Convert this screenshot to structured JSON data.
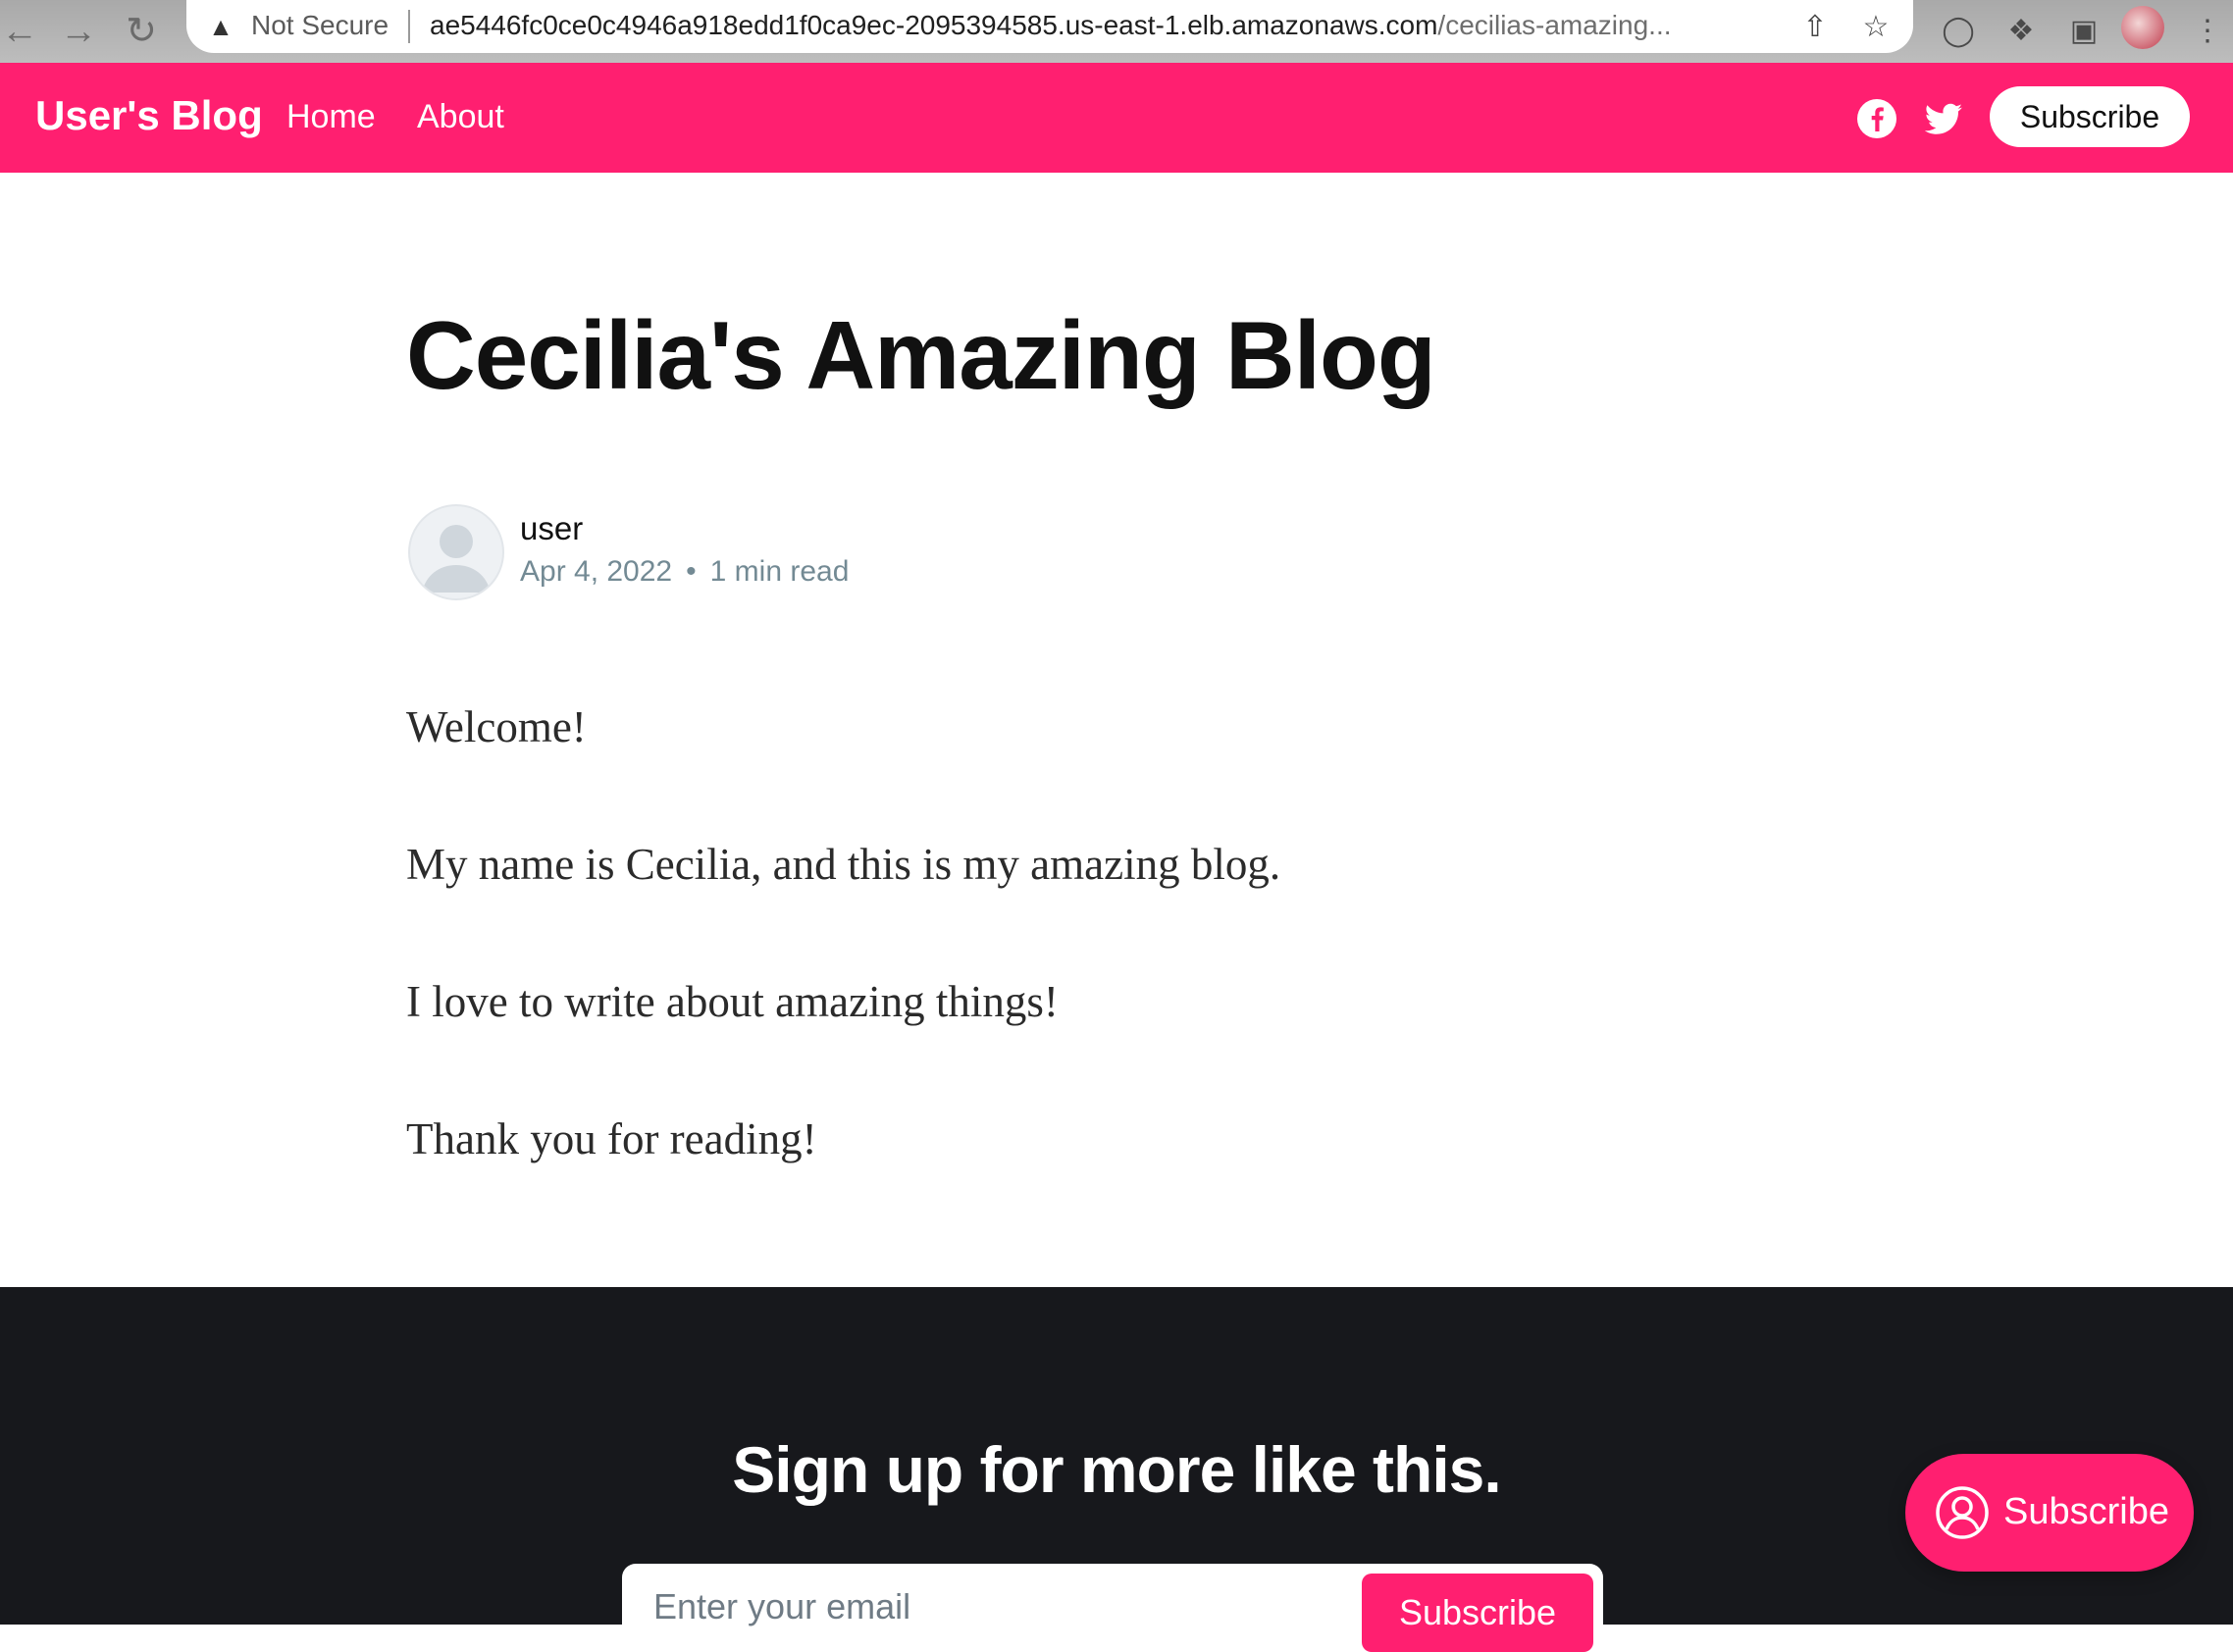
{
  "browser": {
    "security_label": "Not Secure",
    "url_main": "ae5446fc0ce0c4946a918edd1f0ca9ec-2095394585.us-east-1.elb.amazonaws.com",
    "url_rest": "/cecilias-amazing..."
  },
  "header": {
    "brand": "User's Blog",
    "nav": [
      {
        "label": "Home"
      },
      {
        "label": "About"
      }
    ],
    "subscribe_label": "Subscribe",
    "accent_color": "#ff1f70"
  },
  "article": {
    "title": "Cecilia's Amazing Blog",
    "author": "user",
    "date": "Apr 4, 2022",
    "separator": "•",
    "read_time": "1 min read",
    "paragraphs": [
      "Welcome!",
      "My name is Cecilia, and this is my amazing blog.",
      "I love to write about amazing things!",
      "Thank you for reading!"
    ]
  },
  "signup": {
    "title": "Sign up for more like this.",
    "email_placeholder": "Enter your email",
    "button_label": "Subscribe"
  },
  "portal": {
    "label": "Subscribe"
  }
}
